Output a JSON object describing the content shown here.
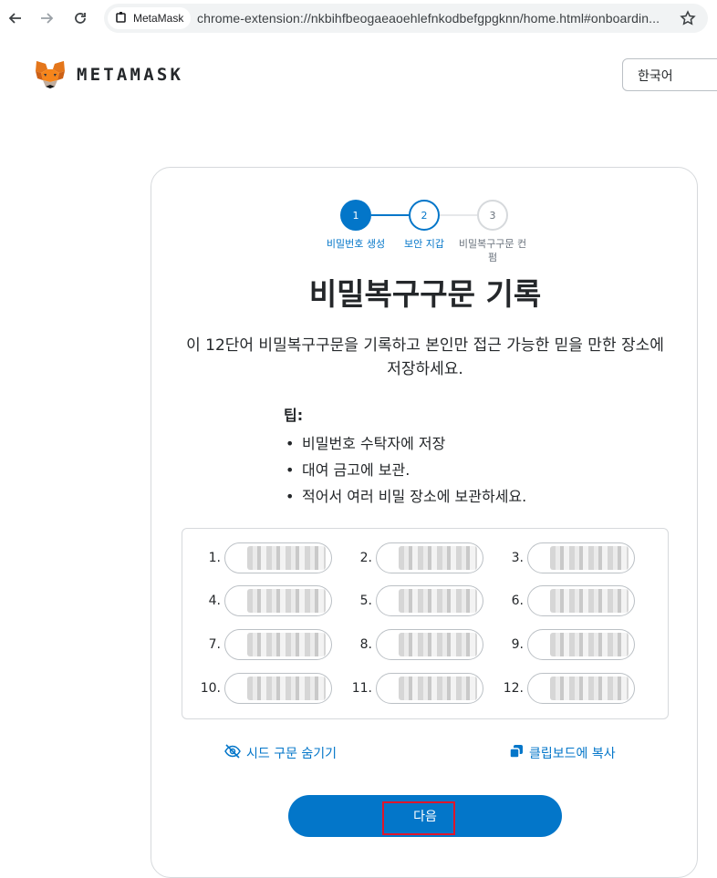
{
  "browser": {
    "tab_chip_label": "MetaMask",
    "url": "chrome-extension://nkbihfbeogaeaoehlefnkodbefgpgknn/home.html#onboardin..."
  },
  "header": {
    "logo_text": "METAMASK",
    "language": "한국어"
  },
  "stepper": {
    "steps": [
      {
        "number": "1",
        "label": "비밀번호 생성"
      },
      {
        "number": "2",
        "label": "보안 지갑"
      },
      {
        "number": "3",
        "label": "비밀복구구문 컨펌"
      }
    ]
  },
  "main": {
    "title": "비밀복구구문 기록",
    "description": "이 12단어 비밀복구구문을 기록하고 본인만 접근 가능한 믿을 만한 장소에 저장하세요.",
    "tips_title": "팁:",
    "tips": [
      "비밀번호 수탁자에 저장",
      "대여 금고에 보관.",
      "적어서 여러 비밀 장소에 보관하세요."
    ],
    "word_numbers": [
      "1.",
      "2.",
      "3.",
      "4.",
      "5.",
      "6.",
      "7.",
      "8.",
      "9.",
      "10.",
      "11.",
      "12."
    ],
    "hide_seed_label": "시드 구문 숨기기",
    "copy_label": "클립보드에 복사",
    "next_label": "다음"
  },
  "colors": {
    "primary": "#0376c9",
    "border": "#d6d9dc",
    "highlight": "#e0162b"
  }
}
